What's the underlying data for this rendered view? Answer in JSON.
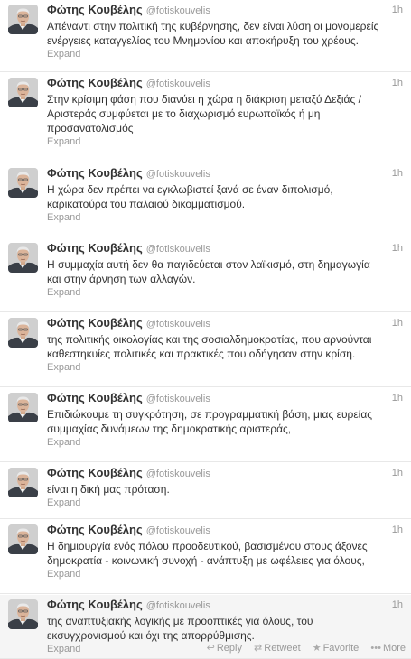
{
  "author": {
    "name": "Φώτης Κουβέλης",
    "handle": "@fotiskouvelis"
  },
  "expand_label": "Expand",
  "actions": {
    "reply": "Reply",
    "retweet": "Retweet",
    "favorite": "Favorite",
    "more": "More",
    "reply_icon": "↩",
    "retweet_icon": "⇄",
    "favorite_icon": "★",
    "more_icon": "•••"
  },
  "tweets": [
    {
      "time": "1h",
      "lines": [
        "Απέναντι στην πολιτική της κυβέρνησης, δεν είναι λύση οι μονομερείς",
        "ενέργειες καταγγελίας του Μνημονίου και αποκήρυξη του χρέους."
      ]
    },
    {
      "time": "1h",
      "lines": [
        "Στην κρίσιμη φάση που διανύει η χώρα η διάκριση μεταξύ Δεξιάς /",
        "Αριστεράς συμφύεται με το διαχωρισμό ευρωπαϊκός ή μη",
        "προσανατολισμός"
      ]
    },
    {
      "time": "1h",
      "lines": [
        "Η χώρα δεν πρέπει να εγκλωβιστεί ξανά σε έναν διπολισμό,",
        "καρικατούρα του παλαιού δικομματισμού."
      ]
    },
    {
      "time": "1h",
      "lines": [
        "Η συμμαχία αυτή δεν θα παγιδεύεται στον λαϊκισμό, στη δημαγωγία",
        "και στην άρνηση των αλλαγών."
      ]
    },
    {
      "time": "1h",
      "lines": [
        "της πολιτικής οικολογίας και της σοσιαλδημοκρατίας, που αρνούνται",
        "καθεστηκυίες πολιτικές και πρακτικές που οδήγησαν στην κρίση."
      ]
    },
    {
      "time": "1h",
      "lines": [
        "Επιδιώκουμε τη συγκρότηση, σε προγραμματική βάση, μιας ευρείας",
        "συμμαχίας δυνάμεων της δημοκρατικής αριστεράς,"
      ]
    },
    {
      "time": "1h",
      "lines": [
        "είναι η δική μας πρόταση."
      ]
    },
    {
      "time": "1h",
      "lines": [
        "Η δημιουργία ενός πόλου προοδευτικού, βασισμένου στους άξονες",
        "δημοκρατία - κοινωνική συνοχή - ανάπτυξη με ωφέλειες για όλους,"
      ]
    },
    {
      "time": "1h",
      "lines": [
        "της αναπτυξιακής λογικής με προοπτικές για όλους, του",
        "εκσυγχρονισμού και όχι της απορρύθμισης."
      ]
    }
  ]
}
